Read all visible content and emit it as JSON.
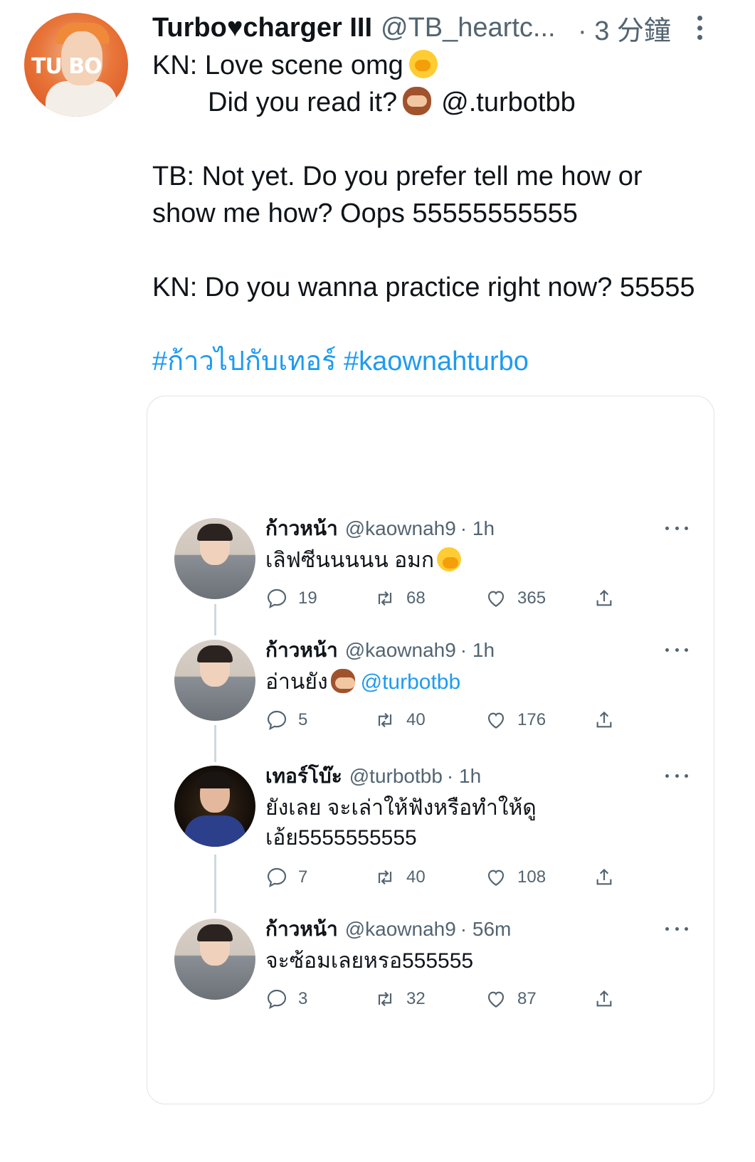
{
  "tweet": {
    "author_name": "Turbo♥charger III",
    "author_handle": "@TB_heartc...",
    "time": "· 3 分鐘",
    "avatar_text": "TU BO",
    "lines": {
      "l1": "KN: Love scene omg",
      "l2": "Did you read it?",
      "l2_mention": "@.turbotbb",
      "l4": "TB: Not yet. Do you prefer tell me how or",
      "l5": "show me how? Oops 55555555555",
      "l7": "KN: Do you wanna practice right now? 55555",
      "hashtags": "#ก้าวไปกับเทอร์ #kaownahturbo"
    },
    "icons": {
      "emoji_1": "face-with-hand-over-mouth-emoji",
      "emoji_2": "see-no-evil-monkey-emoji",
      "more": "more-vertical-icon"
    }
  },
  "embedded_thread": [
    {
      "name": "ก้าวหน้า",
      "handle": "@kaownah9",
      "time": "· 1h",
      "text": "เลิฟซีนนนนน อมก",
      "mention": "",
      "replies": "19",
      "retweets": "68",
      "likes": "365"
    },
    {
      "name": "ก้าวหน้า",
      "handle": "@kaownah9",
      "time": "· 1h",
      "text": "อ่านยัง",
      "mention": "@turbotbb",
      "replies": "5",
      "retweets": "40",
      "likes": "176"
    },
    {
      "name": "เทอร์โบ๊ะ",
      "handle": "@turbotbb",
      "time": "· 1h",
      "text": "ยังเลย จะเล่าให้ฟังหรือทำให้ดู",
      "text2": "เอ้ย5555555555",
      "mention": "",
      "replies": "7",
      "retweets": "40",
      "likes": "108"
    },
    {
      "name": "ก้าวหน้า",
      "handle": "@kaownah9",
      "time": "· 56m",
      "text": "จะซ้อมเลยหรอ555555",
      "mention": "",
      "replies": "3",
      "retweets": "32",
      "likes": "87"
    }
  ],
  "colors": {
    "link": "#1d9bf0",
    "text": "#0f1419",
    "secondary": "#536471",
    "border": "#dfe3e7"
  }
}
